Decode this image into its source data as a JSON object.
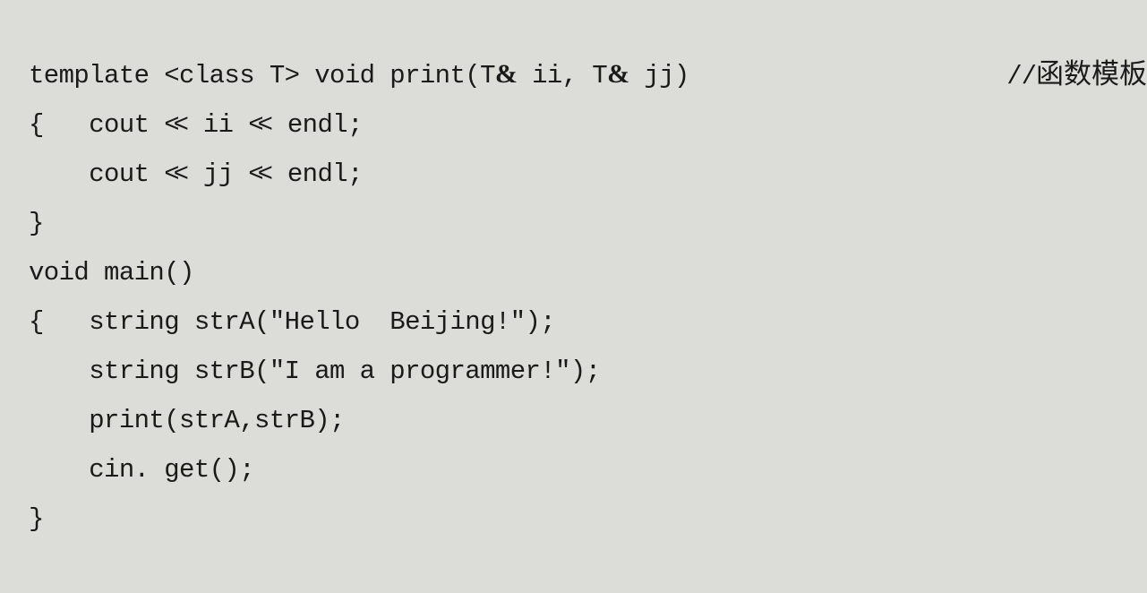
{
  "document": {
    "kind": "source-code-listing",
    "language": "C++",
    "background_color": "#dcdcd8",
    "text_color": "#1a1a1a"
  },
  "code": {
    "lines": [
      {
        "id": "line-1",
        "text": "template <class T> void print(T& ii, T& jj)",
        "comment": "//函数模板",
        "comment_slashes": "//",
        "comment_cjk": "函数模板"
      },
      {
        "id": "line-2",
        "text": "{   cout << ii << endl;"
      },
      {
        "id": "line-3",
        "text": "    cout << jj << endl;"
      },
      {
        "id": "line-4",
        "text": "}"
      },
      {
        "id": "line-5",
        "text": "void main()"
      },
      {
        "id": "line-6",
        "text": "{   string strA(\"Hello  Beijing!\");"
      },
      {
        "id": "line-7",
        "text": "    string strB(\"I am a programmer!\");"
      },
      {
        "id": "line-8",
        "text": "    print(strA,strB);"
      },
      {
        "id": "line-9",
        "text": "    cin. get();"
      },
      {
        "id": "line-10",
        "text": "}"
      }
    ]
  }
}
